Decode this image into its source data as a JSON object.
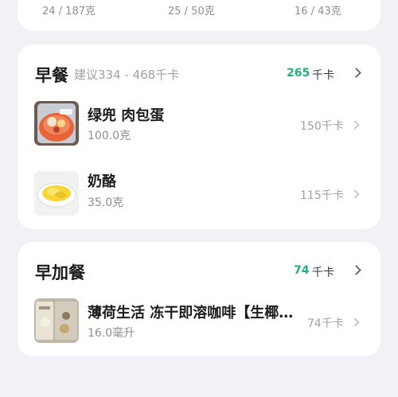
{
  "top_card": {
    "macros": [
      "24 / 187克",
      "25 / 50克",
      "16 / 43克"
    ]
  },
  "breakfast": {
    "title": "早餐",
    "suggestion": "建议334 - 468千卡",
    "kcal": "265",
    "unit": "千卡",
    "items": [
      {
        "name": "绿兜 肉包蛋",
        "qty": "100.0克",
        "kcal": "150千卡",
        "icon": "meat-bun-photo"
      },
      {
        "name": "奶酪",
        "qty": "35.0克",
        "kcal": "115千卡",
        "icon": "cheese-plate-photo"
      }
    ]
  },
  "snack": {
    "title": "早加餐",
    "kcal": "74",
    "unit": "千卡",
    "items": [
      {
        "name": "薄荷生活 冻干即溶咖啡【生椰…",
        "qty": "16.0毫升",
        "kcal": "74千卡",
        "icon": "coffee-package-photo"
      }
    ]
  },
  "colors": {
    "accent": "#21b17b",
    "background": "#f2f2f6",
    "card": "#ffffff"
  }
}
